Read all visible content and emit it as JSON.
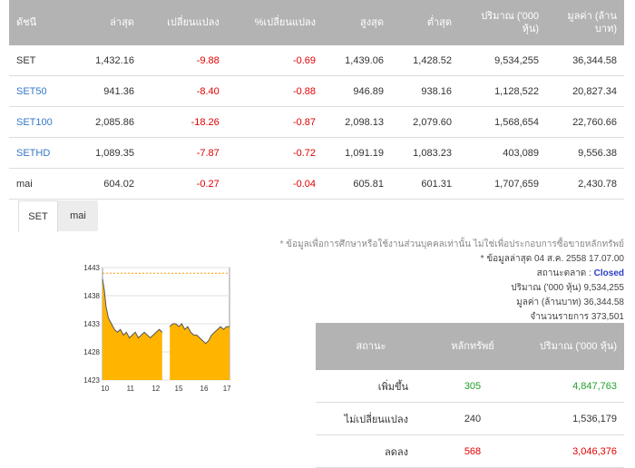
{
  "index_table": {
    "headers": [
      "ดัชนี",
      "ล่าสุด",
      "เปลี่ยนแปลง",
      "%เปลี่ยนแปลง",
      "สูงสุด",
      "ต่ำสุด",
      "ปริมาณ ('000 หุ้น)",
      "มูลค่า (ล้านบาท)"
    ],
    "rows": [
      {
        "name": "SET",
        "last": "1,432.16",
        "change": "-9.88",
        "pct": "-0.69",
        "high": "1,439.06",
        "low": "1,428.52",
        "volume": "9,534,255",
        "value": "36,344.58",
        "link": false
      },
      {
        "name": "SET50",
        "last": "941.36",
        "change": "-8.40",
        "pct": "-0.88",
        "high": "946.89",
        "low": "938.16",
        "volume": "1,128,522",
        "value": "20,827.34",
        "link": true
      },
      {
        "name": "SET100",
        "last": "2,085.86",
        "change": "-18.26",
        "pct": "-0.87",
        "high": "2,098.13",
        "low": "2,079.60",
        "volume": "1,568,654",
        "value": "22,760.66",
        "link": true
      },
      {
        "name": "SETHD",
        "last": "1,089.35",
        "change": "-7.87",
        "pct": "-0.72",
        "high": "1,091.19",
        "low": "1,083.23",
        "volume": "403,089",
        "value": "9,556.38",
        "link": true
      },
      {
        "name": "mai",
        "last": "604.02",
        "change": "-0.27",
        "pct": "-0.04",
        "high": "605.81",
        "low": "601.31",
        "volume": "1,707,659",
        "value": "2,430.78",
        "link": false
      }
    ]
  },
  "tabs": [
    {
      "label": "SET",
      "active": true
    },
    {
      "label": "mai",
      "active": false
    }
  ],
  "chart_data": {
    "type": "area",
    "x_ticks": [
      "10",
      "11",
      "12",
      "15",
      "16",
      "17"
    ],
    "y_ticks": [
      1443,
      1438,
      1433,
      1428,
      1423
    ],
    "ylim": [
      1423,
      1443
    ],
    "reference_line": 1442,
    "series": [
      {
        "segment": "morning",
        "x": [
          0,
          0.03,
          0.06,
          0.1,
          0.15,
          0.2,
          0.25,
          0.3,
          0.35,
          0.4,
          0.45,
          0.5,
          0.55,
          0.6,
          0.65,
          0.7,
          0.75,
          0.8,
          0.85,
          0.9,
          0.95,
          1.0
        ],
        "values": [
          1441,
          1439,
          1436,
          1434,
          1433,
          1432,
          1431.5,
          1432,
          1431,
          1431.5,
          1430.5,
          1431,
          1431.5,
          1430.5,
          1431,
          1431.5,
          1431,
          1430.5,
          1431,
          1431.5,
          1432,
          1431.5
        ]
      },
      {
        "segment": "afternoon",
        "x": [
          0,
          0.05,
          0.1,
          0.15,
          0.2,
          0.25,
          0.3,
          0.35,
          0.4,
          0.45,
          0.5,
          0.55,
          0.6,
          0.65,
          0.7,
          0.75,
          0.8,
          0.85,
          0.9,
          0.95,
          1.0
        ],
        "values": [
          1432.5,
          1433,
          1433,
          1432.5,
          1433,
          1432,
          1432.5,
          1431.5,
          1431,
          1431,
          1430.5,
          1430,
          1429.5,
          1430,
          1431,
          1431.5,
          1432,
          1432.5,
          1432,
          1432.5,
          1432.5
        ]
      }
    ],
    "colors": {
      "fill": "#ffb400",
      "line": "#555555",
      "ref": "#ff9900"
    }
  },
  "info": {
    "disclaimer": "* ข้อมูลเพื่อการศึกษาหรือใช้งานส่วนบุคคลเท่านั้น ไม่ใช่เพื่อประกอบการซื้อขายหลักทรัพย์",
    "updated": "* ข้อมูลล่าสุด 04 ส.ค. 2558 17.07.00",
    "market_status_label": "สถานะตลาด :",
    "market_status": "Closed",
    "volume_label": "ปริมาณ ('000 หุ้น)",
    "volume": "9,534,255",
    "value_label": "มูลค่า (ล้านบาท)",
    "value": "36,344.58",
    "trades_label": "จำนวนรายการ",
    "trades": "373,501"
  },
  "summary_table": {
    "headers": [
      "สถานะ",
      "หลักทรัพย์",
      "ปริมาณ ('000 หุ้น)"
    ],
    "rows": [
      {
        "label": "เพิ่มขึ้น",
        "count": "305",
        "volume": "4,847,763",
        "tone": "pos"
      },
      {
        "label": "ไม่เปลี่ยนแปลง",
        "count": "240",
        "volume": "1,536,179",
        "tone": ""
      },
      {
        "label": "ลดลง",
        "count": "568",
        "volume": "3,046,376",
        "tone": "neg"
      }
    ]
  }
}
